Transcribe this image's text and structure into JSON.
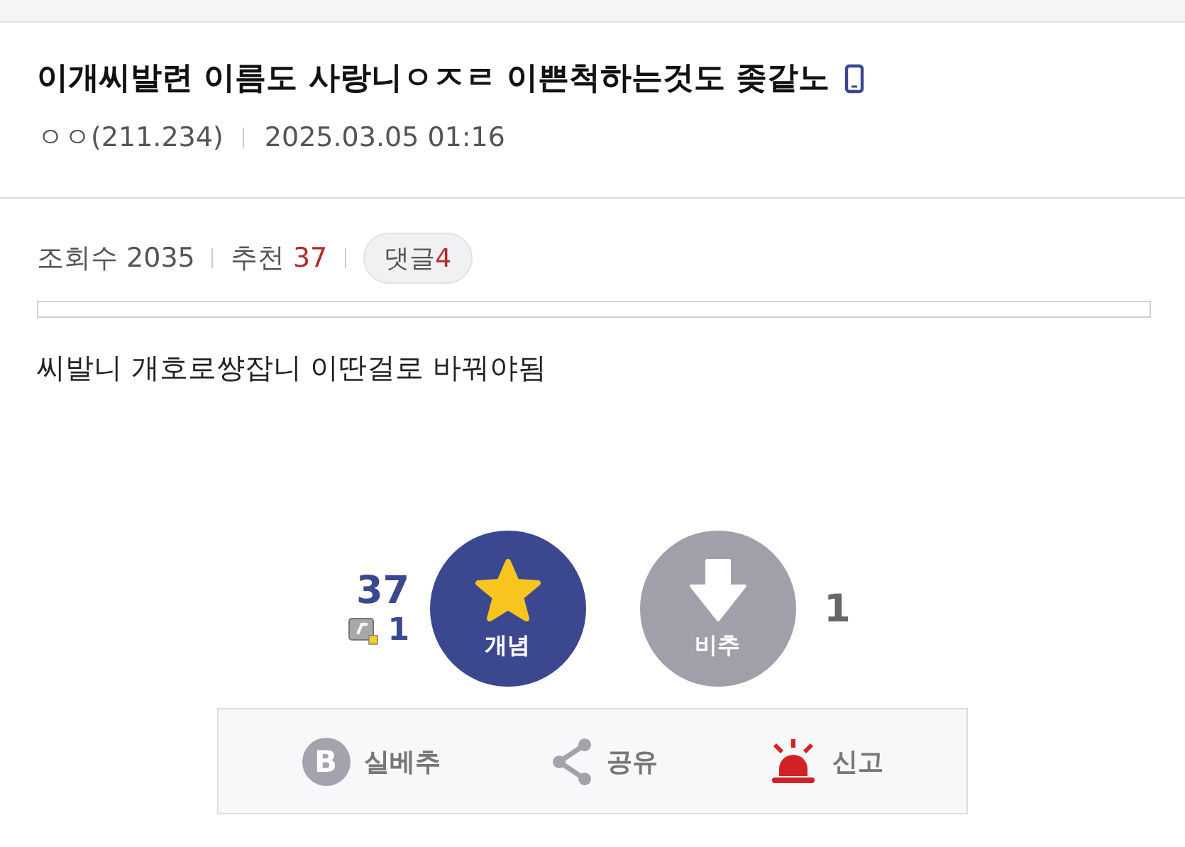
{
  "post": {
    "title": "이개씨발련 이름도 사랑니ㅇㅈㄹ 이쁜척하는것도 좆같노",
    "mobile": true,
    "author": "ㅇㅇ(211.234)",
    "date": "2025.03.05 01:16"
  },
  "stats": {
    "views_label": "조회수",
    "views": "2035",
    "recommend_label": "추천",
    "recommend": "37",
    "comments_label": "댓글",
    "comments": "4"
  },
  "body": "씨발니 개호로썅잡니 이딴걸로 바꿔야됨",
  "vote": {
    "up_count": "37",
    "fixed_count": "1",
    "up_label": "개념",
    "down_label": "비추",
    "down_count": "1"
  },
  "actions": [
    {
      "kind": "best",
      "icon_text": "B",
      "label": "실베추"
    },
    {
      "kind": "share",
      "label": "공유"
    },
    {
      "kind": "report",
      "label": "신고"
    }
  ]
}
